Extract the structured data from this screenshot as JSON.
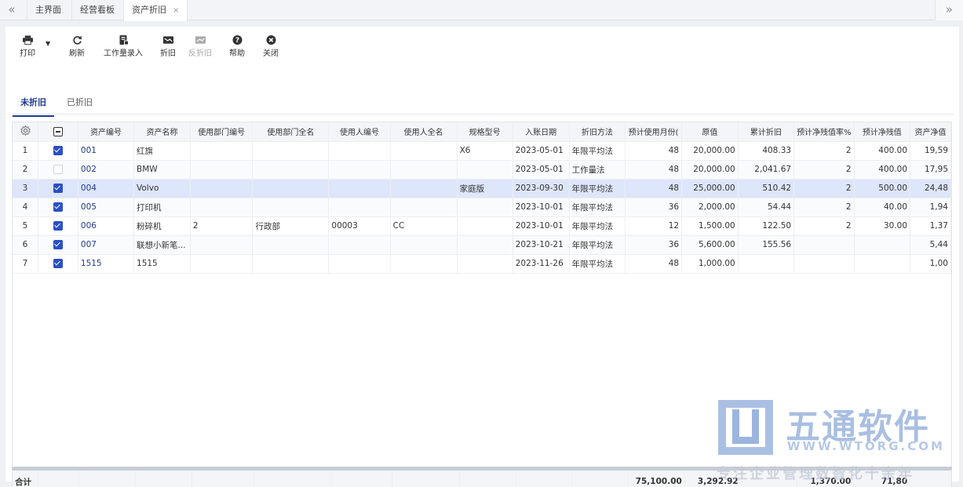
{
  "tabbar": {
    "tabs": [
      {
        "label": "主界面"
      },
      {
        "label": "经营看板"
      },
      {
        "label": "资产折旧",
        "close": "×"
      }
    ]
  },
  "toolbar": {
    "print": "打印",
    "refresh": "刷新",
    "workload": "工作量录入",
    "depreciate": "折旧",
    "undo_depreciate": "反折旧",
    "help": "帮助",
    "close": "关闭"
  },
  "subtabs": {
    "undepreciated": "未折旧",
    "depreciated": "已折旧"
  },
  "columns": [
    "资产编号",
    "资产名称",
    "使用部门编号",
    "使用部门全名",
    "使用人编号",
    "使用人全名",
    "规格型号",
    "入账日期",
    "折旧方法",
    "预计使用月份(",
    "原值",
    "累计折旧",
    "预计净残值率%",
    "预计净残值",
    "资产净值"
  ],
  "rows": [
    {
      "no": "1",
      "checked": true,
      "code": "001",
      "name": "红旗",
      "dept_no": "",
      "dept": "",
      "user_no": "",
      "user": "",
      "spec": "X6",
      "date": "2023-05-01",
      "method": "年限平均法",
      "months": "48",
      "original": "20,000.00",
      "accum": "408.33",
      "rate": "2",
      "residual": "400.00",
      "net": "19,59"
    },
    {
      "no": "2",
      "checked": false,
      "code": "002",
      "name": "BMW",
      "dept_no": "",
      "dept": "",
      "user_no": "",
      "user": "",
      "spec": "",
      "date": "2023-05-01",
      "method": "工作量法",
      "months": "48",
      "original": "20,000.00",
      "accum": "2,041.67",
      "rate": "2",
      "residual": "400.00",
      "net": "17,95"
    },
    {
      "no": "3",
      "checked": true,
      "code": "004",
      "name": "Volvo",
      "dept_no": "",
      "dept": "",
      "user_no": "",
      "user": "",
      "spec": "家庭版",
      "date": "2023-09-30",
      "method": "年限平均法",
      "months": "48",
      "original": "25,000.00",
      "accum": "510.42",
      "rate": "2",
      "residual": "500.00",
      "net": "24,48"
    },
    {
      "no": "4",
      "checked": true,
      "code": "005",
      "name": "打印机",
      "dept_no": "",
      "dept": "",
      "user_no": "",
      "user": "",
      "spec": "",
      "date": "2023-10-01",
      "method": "年限平均法",
      "months": "36",
      "original": "2,000.00",
      "accum": "54.44",
      "rate": "2",
      "residual": "40.00",
      "net": "1,94"
    },
    {
      "no": "5",
      "checked": true,
      "code": "006",
      "name": "粉碎机",
      "dept_no": "2",
      "dept": "行政部",
      "user_no": "00003",
      "user": "CC",
      "spec": "",
      "date": "2023-10-01",
      "method": "年限平均法",
      "months": "12",
      "original": "1,500.00",
      "accum": "122.50",
      "rate": "2",
      "residual": "30.00",
      "net": "1,37"
    },
    {
      "no": "6",
      "checked": true,
      "code": "007",
      "name": "联想小新笔...",
      "dept_no": "",
      "dept": "",
      "user_no": "",
      "user": "",
      "spec": "",
      "date": "2023-10-21",
      "method": "年限平均法",
      "months": "36",
      "original": "5,600.00",
      "accum": "155.56",
      "rate": "",
      "residual": "",
      "net": "5,44"
    },
    {
      "no": "7",
      "checked": true,
      "code": "1515",
      "name": "1515",
      "dept_no": "",
      "dept": "",
      "user_no": "",
      "user": "",
      "spec": "",
      "date": "2023-11-26",
      "method": "年限平均法",
      "months": "48",
      "original": "1,000.00",
      "accum": "",
      "rate": "",
      "residual": "",
      "net": "1,00"
    }
  ],
  "footer": {
    "label": "合计",
    "original": "75,100.00",
    "accum": "3,292.92",
    "residual": "1,370.00",
    "net": "71,80"
  },
  "watermark": {
    "cn": "五通软件",
    "url": "WWW.WTORG.COM",
    "slogan": "专注企业管理数智化十余年"
  },
  "colors": {
    "accent": "#1f3b8f",
    "checkbox": "#2b4fc4",
    "selected_row": "#dde6fa"
  }
}
